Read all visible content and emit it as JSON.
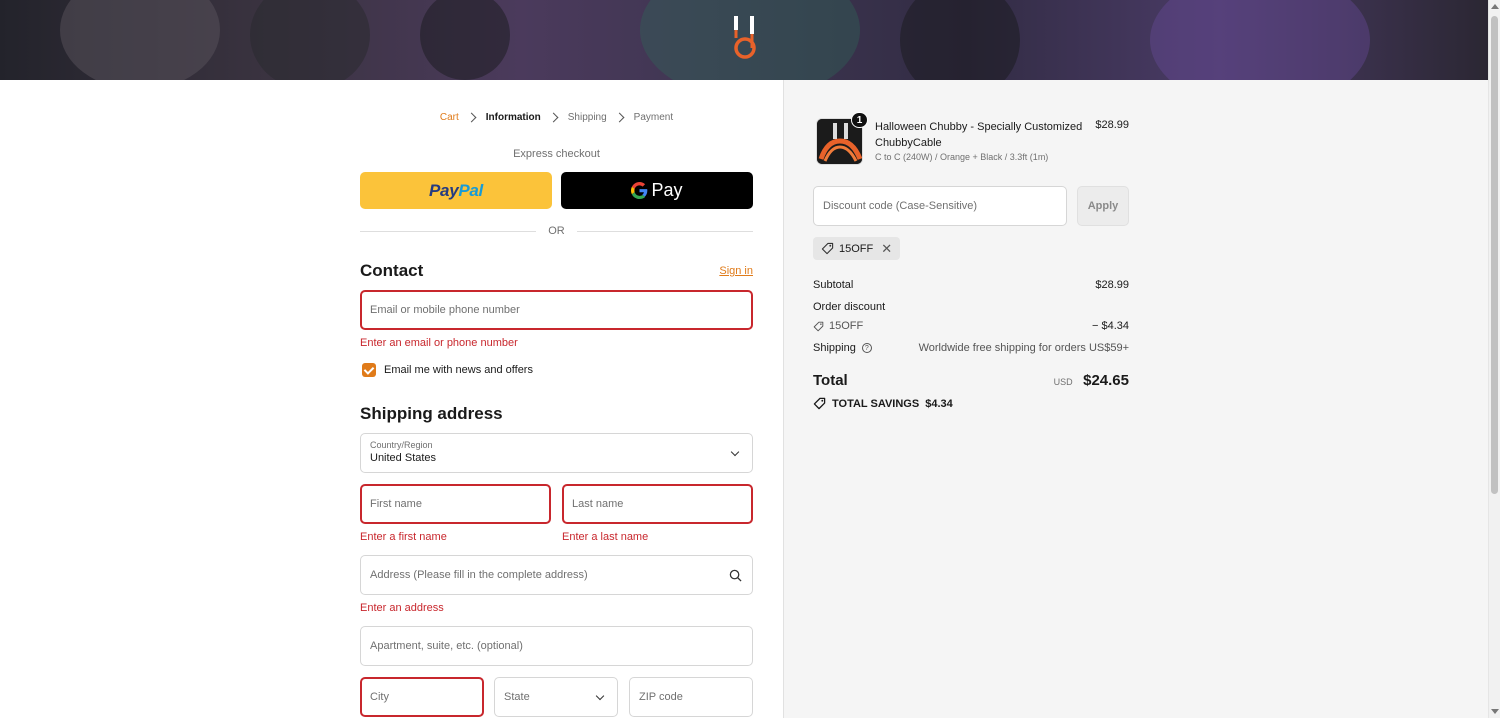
{
  "breadcrumb": {
    "items": [
      {
        "label": "Cart"
      },
      {
        "label": "Information"
      },
      {
        "label": "Shipping"
      },
      {
        "label": "Payment"
      }
    ]
  },
  "express": {
    "label": "Express checkout",
    "paypal_part1": "Pay",
    "paypal_part2": "Pal",
    "gpay_label": "Pay",
    "or_label": "OR"
  },
  "contact": {
    "title": "Contact",
    "sign_in": "Sign in",
    "email_placeholder": "Email or mobile phone number",
    "email_error": "Enter an email or phone number",
    "newsletter_label": "Email me with news and offers",
    "newsletter_checked": true
  },
  "shipping": {
    "title": "Shipping address",
    "country_label": "Country/Region",
    "country_value": "United States",
    "first_name_placeholder": "First name",
    "first_name_error": "Enter a first name",
    "last_name_placeholder": "Last name",
    "last_name_error": "Enter a last name",
    "address_placeholder": "Address (Please fill in the complete address)",
    "address_error": "Enter an address",
    "apartment_placeholder": "Apartment, suite, etc. (optional)",
    "city_placeholder": "City",
    "state_placeholder": "State",
    "zip_placeholder": "ZIP code"
  },
  "summary": {
    "product": {
      "quantity": "1",
      "name": "Halloween Chubby - Specially Customized ChubbyCable",
      "variant": "C to C (240W) / Orange + Black / 3.3ft (1m)",
      "price": "$28.99"
    },
    "discount_placeholder": "Discount code (Case-Sensitive)",
    "apply_label": "Apply",
    "applied_code": "15OFF",
    "subtotal_label": "Subtotal",
    "subtotal_value": "$28.99",
    "order_discount_label": "Order discount",
    "discount_code": "15OFF",
    "discount_value": "− $4.34",
    "shipping_label": "Shipping",
    "shipping_value": "Worldwide free shipping for orders US$59+",
    "total_label": "Total",
    "currency": "USD",
    "total_value": "$24.65",
    "savings_label": "TOTAL SAVINGS",
    "savings_value": "$4.34"
  },
  "colors": {
    "accent": "#e07b1a",
    "error": "#c8272d",
    "paypal_yellow": "#fbc33a"
  }
}
